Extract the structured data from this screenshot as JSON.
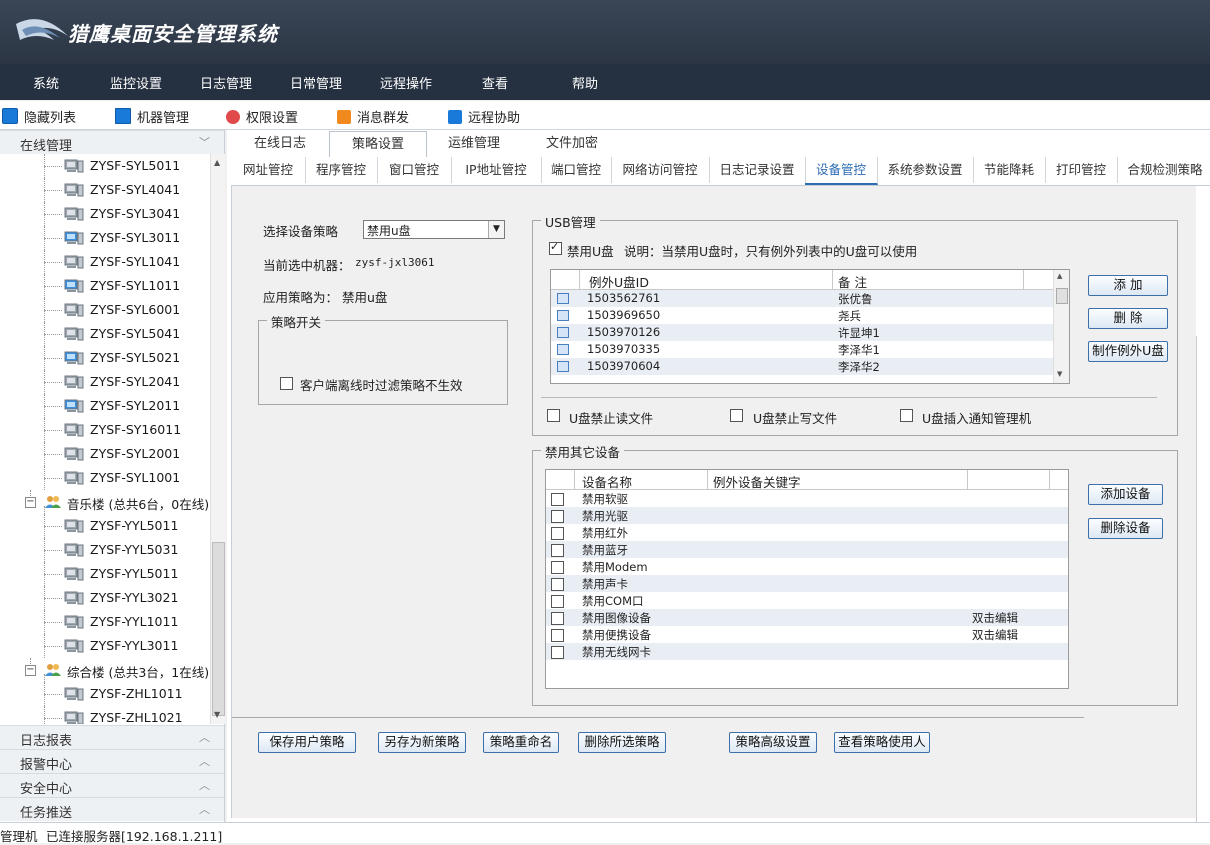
{
  "app": {
    "title": "猎鹰桌面安全管理系统"
  },
  "menu": [
    "系统",
    "监控设置",
    "日志管理",
    "日常管理",
    "远程操作",
    "查看",
    "帮助"
  ],
  "toolbar": {
    "items": [
      {
        "label": "隐藏列表",
        "icon": "list-icon",
        "color": "#1a7ad9"
      },
      {
        "label": "机器管理",
        "icon": "monitor-icon",
        "color": "#1a7ad9"
      },
      {
        "label": "权限设置",
        "icon": "user-permission-icon",
        "color": "#e04a4a"
      },
      {
        "label": "消息群发",
        "icon": "message-icon",
        "color": "#f08a1c"
      },
      {
        "label": "远程协助",
        "icon": "remote-assist-icon",
        "color": "#1a7ad9"
      }
    ]
  },
  "left_panel": {
    "online_header": "在线管理",
    "tree": [
      {
        "type": "pc",
        "label": "ZYSF-SYL5011",
        "online": false
      },
      {
        "type": "pc",
        "label": "ZYSF-SYL4041",
        "online": false
      },
      {
        "type": "pc",
        "label": "ZYSF-SYL3041",
        "online": false
      },
      {
        "type": "pc",
        "label": "ZYSF-SYL3011",
        "online": true
      },
      {
        "type": "pc",
        "label": "ZYSF-SYL1041",
        "online": false
      },
      {
        "type": "pc",
        "label": "ZYSF-SYL1011",
        "online": true
      },
      {
        "type": "pc",
        "label": "ZYSF-SYL6001",
        "online": false
      },
      {
        "type": "pc",
        "label": "ZYSF-SYL5041",
        "online": false
      },
      {
        "type": "pc",
        "label": "ZYSF-SYL5021",
        "online": true
      },
      {
        "type": "pc",
        "label": "ZYSF-SYL2041",
        "online": false
      },
      {
        "type": "pc",
        "label": "ZYSF-SYL2011",
        "online": true
      },
      {
        "type": "pc",
        "label": "ZYSF-SY16011",
        "online": false
      },
      {
        "type": "pc",
        "label": "ZYSF-SYL2001",
        "online": false
      },
      {
        "type": "pc",
        "label": "ZYSF-SYL1001",
        "online": false
      },
      {
        "type": "group",
        "label": "音乐楼 (总共6台，0在线)"
      },
      {
        "type": "pc",
        "label": "ZYSF-YYL5011",
        "online": false
      },
      {
        "type": "pc",
        "label": "ZYSF-YYL5031",
        "online": false
      },
      {
        "type": "pc",
        "label": "ZYSF-YYL5011",
        "online": false
      },
      {
        "type": "pc",
        "label": "ZYSF-YYL3021",
        "online": false
      },
      {
        "type": "pc",
        "label": "ZYSF-YYL1011",
        "online": false
      },
      {
        "type": "pc",
        "label": "ZYSF-YYL3011",
        "online": false
      },
      {
        "type": "group",
        "label": "综合楼 (总共3台，1在线)"
      },
      {
        "type": "pc",
        "label": "ZYSF-ZHL1011",
        "online": false
      },
      {
        "type": "pc",
        "label": "ZYSF-ZHL1021",
        "online": false
      }
    ],
    "sections": [
      "日志报表",
      "报警中心",
      "安全中心",
      "任务推送"
    ]
  },
  "tabs_top": [
    "在线日志",
    "策略设置",
    "运维管理",
    "文件加密"
  ],
  "tabs_top_active": 1,
  "tabs_sub": [
    "网址管控",
    "程序管控",
    "窗口管控",
    "IP地址管控",
    "端口管控",
    "网络访问管控",
    "日志记录设置",
    "设备管控",
    "系统参数设置",
    "节能降耗",
    "打印管控",
    "合规检测策略"
  ],
  "tabs_sub_active": 7,
  "device_policy": {
    "select_label": "选择设备策略",
    "select_value": "禁用u盘",
    "current_machine_label": "当前选中机器：",
    "current_machine_value": "zysf-jxl3061",
    "applied_label": "应用策略为：",
    "applied_value": "禁用u盘",
    "switch_group": "策略开关",
    "offline_filter_label": "客户端离线时过滤策略不生效",
    "offline_filter_checked": false
  },
  "usb": {
    "group_title": "USB管理",
    "disable_label": "禁用U盘",
    "disable_checked": true,
    "note": "说明：当禁用U盘时，只有例外列表中的U盘可以使用",
    "columns": [
      "例外U盘ID",
      "备 注"
    ],
    "rows": [
      {
        "id": "1503562761",
        "note": "张优鲁"
      },
      {
        "id": "1503969650",
        "note": "尧兵"
      },
      {
        "id": "1503970126",
        "note": "许显坤1"
      },
      {
        "id": "1503970335",
        "note": "李泽华1"
      },
      {
        "id": "1503970604",
        "note": "李泽华2"
      }
    ],
    "buttons": [
      "添 加",
      "删 除",
      "制作例外U盘"
    ],
    "options": [
      {
        "label": "U盘禁止读文件",
        "checked": false
      },
      {
        "label": "U盘禁止写文件",
        "checked": false
      },
      {
        "label": "U盘插入通知管理机",
        "checked": false
      }
    ]
  },
  "other_devices": {
    "group_title": "禁用其它设备",
    "columns": [
      "设备名称",
      "例外设备关键字"
    ],
    "rows": [
      {
        "name": "禁用软驱",
        "extra": ""
      },
      {
        "name": "禁用光驱",
        "extra": ""
      },
      {
        "name": "禁用红外",
        "extra": ""
      },
      {
        "name": "禁用蓝牙",
        "extra": ""
      },
      {
        "name": "禁用Modem",
        "extra": ""
      },
      {
        "name": "禁用声卡",
        "extra": ""
      },
      {
        "name": "禁用COM口",
        "extra": ""
      },
      {
        "name": "禁用图像设备",
        "extra": "双击编辑"
      },
      {
        "name": "禁用便携设备",
        "extra": "双击编辑"
      },
      {
        "name": "禁用无线网卡",
        "extra": ""
      }
    ],
    "buttons": [
      "添加设备",
      "删除设备"
    ]
  },
  "bottom_buttons": [
    "保存用户策略",
    "另存为新策略",
    "策略重命名",
    "删除所选策略",
    "策略高级设置",
    "查看策略使用人"
  ],
  "status": {
    "role": "管理机",
    "connection": "已连接服务器[192.168.1.211]"
  }
}
